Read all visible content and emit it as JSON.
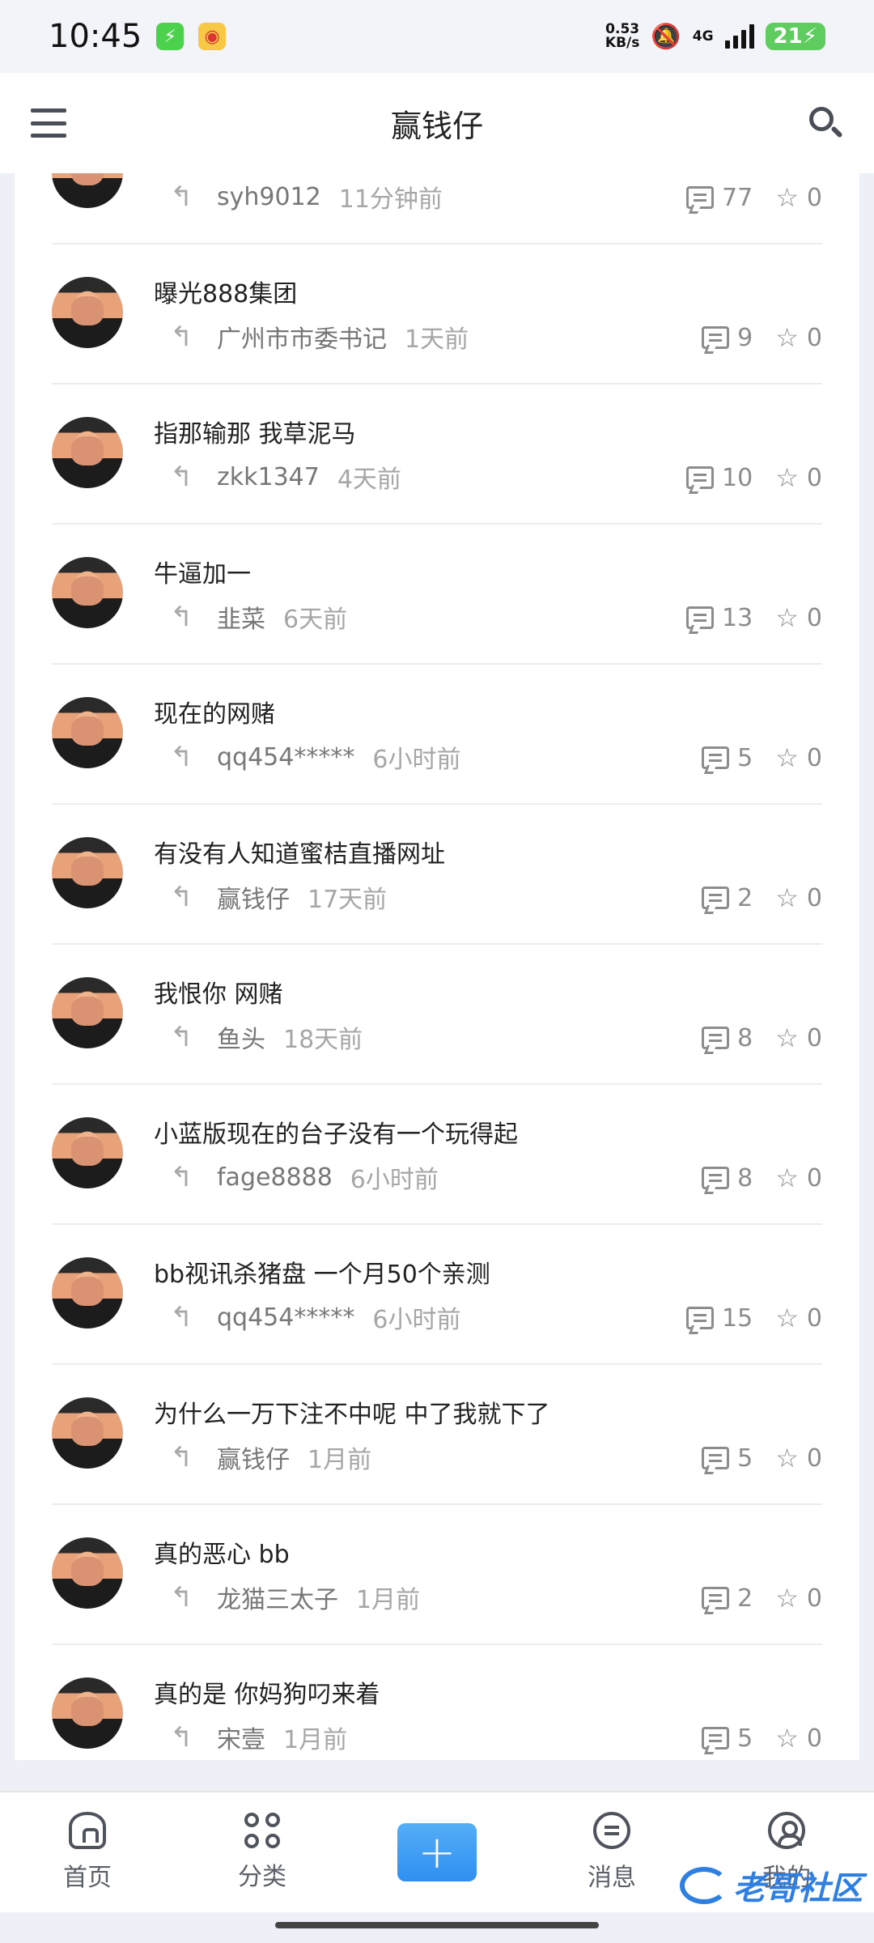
{
  "status_bar": {
    "time": "10:45",
    "net_speed_value": "0.53",
    "net_speed_unit": "KB/s",
    "network": "4G",
    "battery": "21"
  },
  "header": {
    "title": "赢钱仔"
  },
  "posts": [
    {
      "title": "",
      "author": "syh9012",
      "time": "11分钟前",
      "comments": "77",
      "stars": "0"
    },
    {
      "title": "曝光888集团",
      "author": "广州市市委书记",
      "time": "1天前",
      "comments": "9",
      "stars": "0"
    },
    {
      "title": "指那输那 我草泥马",
      "author": "zkk1347",
      "time": "4天前",
      "comments": "10",
      "stars": "0"
    },
    {
      "title": "牛逼加一",
      "author": "韭菜",
      "time": "6天前",
      "comments": "13",
      "stars": "0"
    },
    {
      "title": "现在的网赌",
      "author": "qq454*****",
      "time": "6小时前",
      "comments": "5",
      "stars": "0"
    },
    {
      "title": "有没有人知道蜜桔直播网址",
      "author": "赢钱仔",
      "time": "17天前",
      "comments": "2",
      "stars": "0"
    },
    {
      "title": "我恨你 网赌",
      "author": "鱼头",
      "time": "18天前",
      "comments": "8",
      "stars": "0"
    },
    {
      "title": "小蓝版现在的台子没有一个玩得起",
      "author": "fage8888",
      "time": "6小时前",
      "comments": "8",
      "stars": "0"
    },
    {
      "title": "bb视讯杀猪盘 一个月50个亲测",
      "author": "qq454*****",
      "time": "6小时前",
      "comments": "15",
      "stars": "0"
    },
    {
      "title": "为什么一万下注不中呢 中了我就下了",
      "author": "赢钱仔",
      "time": "1月前",
      "comments": "5",
      "stars": "0"
    },
    {
      "title": "真的恶心 bb",
      "author": "龙猫三太子",
      "time": "1月前",
      "comments": "2",
      "stars": "0"
    },
    {
      "title": "真的是 你妈狗叼来着",
      "author": "宋壹",
      "time": "1月前",
      "comments": "5",
      "stars": "0"
    }
  ],
  "bottom_nav": {
    "home": "首页",
    "category": "分类",
    "add": "+",
    "messages": "消息",
    "mine": "我的"
  },
  "watermark": {
    "text": "老哥社区"
  }
}
